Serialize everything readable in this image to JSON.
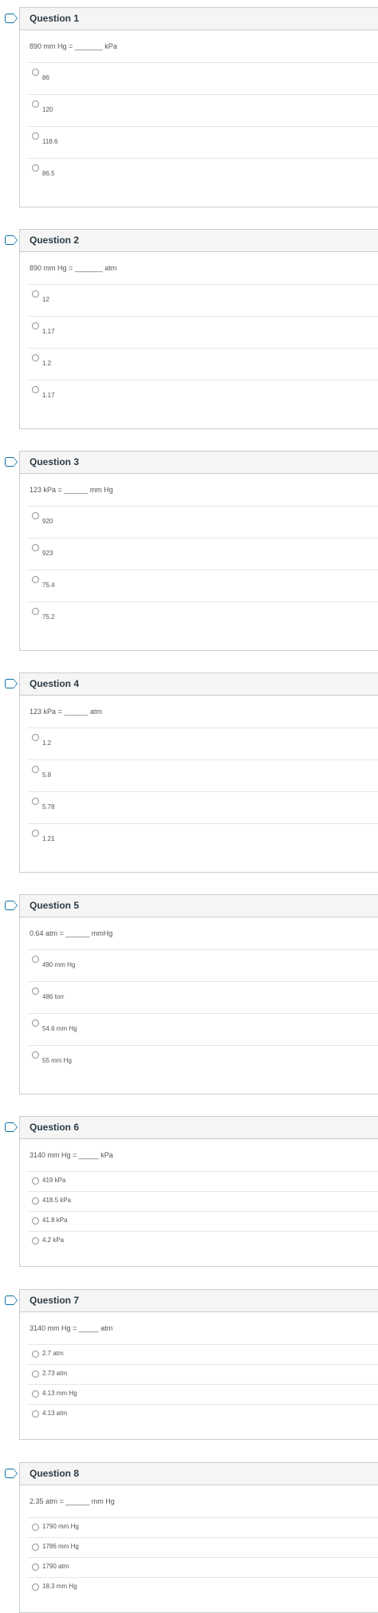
{
  "questions": [
    {
      "title": "Question 1",
      "prompt": "890 mm Hg = _______ kPa",
      "answers": [
        "86",
        "120",
        "118.6",
        "86.5"
      ]
    },
    {
      "title": "Question 2",
      "prompt": "890 mm Hg = _______ atm",
      "answers": [
        "12",
        "1.17",
        "1.2",
        "1.17"
      ]
    },
    {
      "title": "Question 3",
      "prompt": "123 kPa = ______ mm Hg",
      "answers": [
        "920",
        "923",
        "75.4",
        "75.2"
      ]
    },
    {
      "title": "Question 4",
      "prompt": "123 kPa = ______ atm",
      "answers": [
        "1.2",
        "5.8",
        "5.78",
        "1.21"
      ]
    },
    {
      "title": "Question 5",
      "prompt": "0.64 atm = ______ mmHg",
      "answers": [
        "490 mm Hg",
        "486 torr",
        "54.6 mm Hg",
        "55 mm Hg"
      ]
    },
    {
      "title": "Question 6",
      "prompt": "3140 mm Hg = _____ kPa",
      "answers": [
        "419 kPa",
        "418.5 kPa",
        "41.8 kPa",
        "4.2 kPa"
      ]
    },
    {
      "title": "Question 7",
      "prompt": "3140 mm Hg = _____ atm",
      "answers": [
        "2.7 atm",
        "2.73 atm",
        "4.13 mm Hg",
        "4.13 atm"
      ]
    },
    {
      "title": "Question 8",
      "prompt": "2.35 atm = ______ mm Hg",
      "answers": [
        "1790 mm Hg",
        "1786 mm Hg",
        "1790 atm",
        "18.3 mm Hg"
      ]
    }
  ],
  "icons": {
    "flag": "bookmark-flag-icon",
    "radio": "radio-button"
  },
  "colors": {
    "flag": "#0770a3",
    "header_bg": "#f5f5f5",
    "border": "#c7cdd1"
  }
}
